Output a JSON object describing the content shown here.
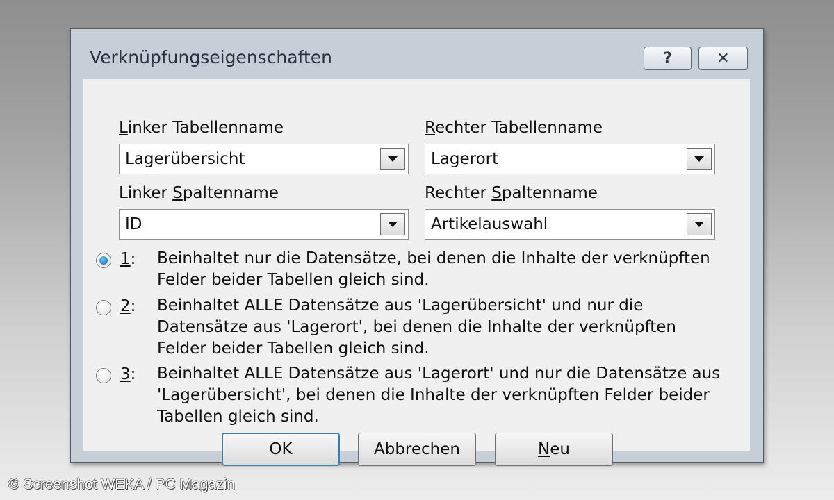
{
  "dialog": {
    "title": "Verknüpfungseigenschaften",
    "help_label": "?",
    "close_label": "✕"
  },
  "left_table": {
    "label_first": "L",
    "label_rest": "inker Tabellenname",
    "value": "Lagerübersicht"
  },
  "right_table": {
    "label_first": "R",
    "label_rest": "echter Tabellenname",
    "value": "Lagerort"
  },
  "left_column": {
    "label_pre": "Linker ",
    "label_ul": "S",
    "label_post": "paltenname",
    "value": "ID"
  },
  "right_column": {
    "label_pre": "Rechter ",
    "label_ul": "S",
    "label_post": "paltenname",
    "value": "Artikelauswahl"
  },
  "options": [
    {
      "num": "1",
      "suffix": ":",
      "selected": true,
      "lines": [
        "Beinhaltet nur die Datensätze, bei denen die Inhalte der verknüpften",
        "Felder beider Tabellen gleich sind."
      ]
    },
    {
      "num": "2",
      "suffix": ":",
      "selected": false,
      "lines": [
        "Beinhaltet ALLE Datensätze aus 'Lagerübersicht' und nur die",
        "Datensätze aus 'Lagerort', bei denen die Inhalte der verknüpften",
        "Felder beider Tabellen gleich sind."
      ]
    },
    {
      "num": "3",
      "suffix": ":",
      "selected": false,
      "lines": [
        "Beinhaltet ALLE Datensätze aus 'Lagerort' und nur die Datensätze aus",
        "'Lagerübersicht', bei denen die Inhalte der verknüpften Felder beider",
        "Tabellen gleich sind."
      ]
    }
  ],
  "buttons": {
    "ok": "OK",
    "cancel": "Abbrechen",
    "new_first": "N",
    "new_rest": "eu"
  },
  "credit": "© Screenshot WEKA / PC Magazin"
}
